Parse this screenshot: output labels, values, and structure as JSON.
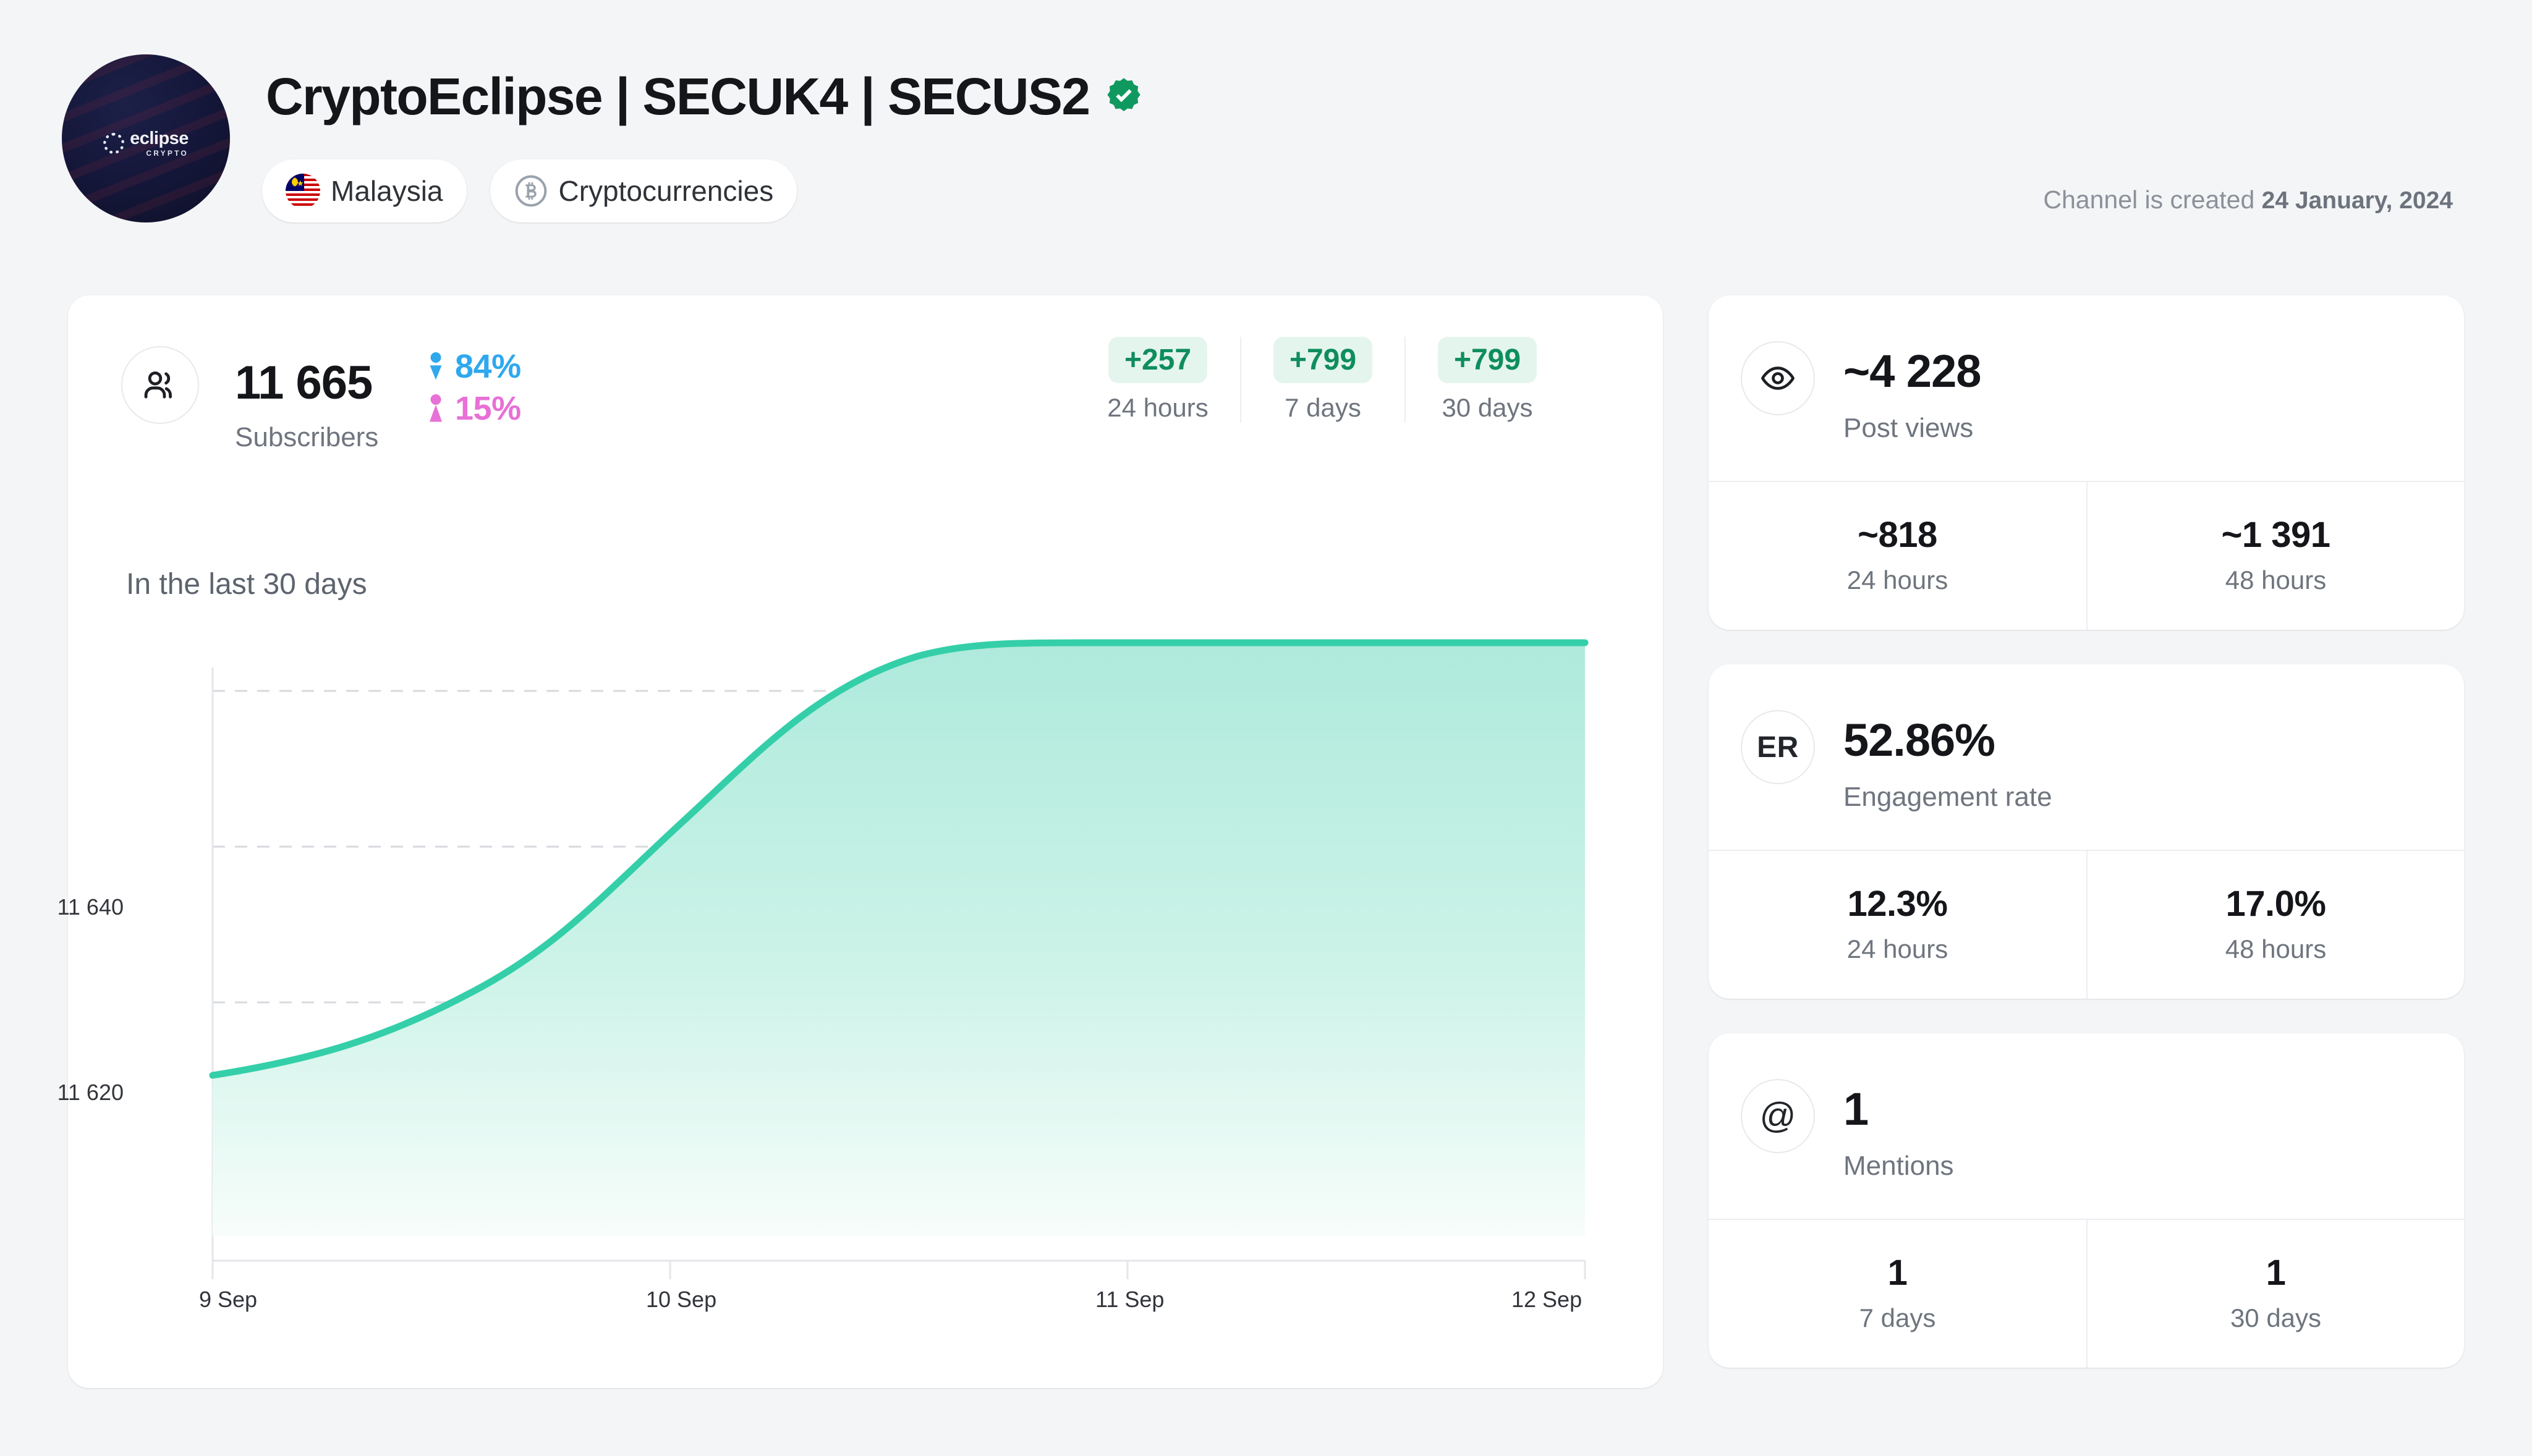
{
  "header": {
    "avatar": {
      "wordmark_primary": "eclipse",
      "wordmark_secondary": "CRYPTO"
    },
    "channel_title": "CryptoEclipse | SECUK4 | SECUS2",
    "verified": true,
    "chips": [
      {
        "icon": "malaysia-flag-icon",
        "label": "Malaysia"
      },
      {
        "icon": "bitcoin-icon",
        "label": "Cryptocurrencies"
      }
    ],
    "created_prefix": "Channel is created",
    "created_date": "24 January, 2024"
  },
  "subscribers": {
    "icon": "users-icon",
    "count": "11 665",
    "label": "Subscribers",
    "gender": {
      "male_pct": "84%",
      "female_pct": "15%",
      "male_color": "#2fa8ed",
      "female_color": "#e870d6"
    },
    "periods": [
      {
        "delta": "+257",
        "label": "24 hours"
      },
      {
        "delta": "+799",
        "label": "7 days"
      },
      {
        "delta": "+799",
        "label": "30 days"
      }
    ],
    "badge_bg": "#e4f5ee",
    "badge_color": "#0f8d5e"
  },
  "chart_section": {
    "title": "In the last 30 days"
  },
  "chart_data": {
    "type": "area",
    "title": "In the last 30 days",
    "xlabel": "",
    "ylabel": "",
    "grid": true,
    "legend": "none",
    "line_color": "#34cfa9",
    "fill_top_color": "#aeeadc",
    "fill_bottom_color": "#f4fdfa",
    "ylim": [
      11608,
      11668
    ],
    "yticks": [
      11620,
      11640
    ],
    "ytick_labels": [
      "11 620",
      "11 640"
    ],
    "xticks": [
      "9 Sep",
      "10 Sep",
      "11 Sep",
      "12 Sep"
    ],
    "x": [
      "9 Sep",
      "9.25 Sep",
      "9.5 Sep",
      "9.75 Sep",
      "10 Sep",
      "10.25 Sep",
      "10.5 Sep",
      "10.75 Sep",
      "11 Sep",
      "11.25 Sep",
      "11.5 Sep",
      "11.75 Sep",
      "12 Sep"
    ],
    "values": [
      11614,
      11616,
      11619,
      11623,
      11628,
      11635,
      11643,
      11652,
      11660,
      11665,
      11665,
      11665,
      11665
    ]
  },
  "side_cards": [
    {
      "icon": "eye-icon",
      "icon_text": "",
      "value": "~4 228",
      "label": "Post views",
      "cells": [
        {
          "value": "~818",
          "label": "24 hours"
        },
        {
          "value": "~1 391",
          "label": "48 hours"
        }
      ]
    },
    {
      "icon": "er-icon",
      "icon_text": "ER",
      "value": "52.86%",
      "label": "Engagement rate",
      "cells": [
        {
          "value": "12.3%",
          "label": "24 hours"
        },
        {
          "value": "17.0%",
          "label": "48 hours"
        }
      ]
    },
    {
      "icon": "at-icon",
      "icon_text": "@",
      "value": "1",
      "label": "Mentions",
      "cells": [
        {
          "value": "1",
          "label": "7 days"
        },
        {
          "value": "1",
          "label": "30 days"
        }
      ]
    }
  ]
}
